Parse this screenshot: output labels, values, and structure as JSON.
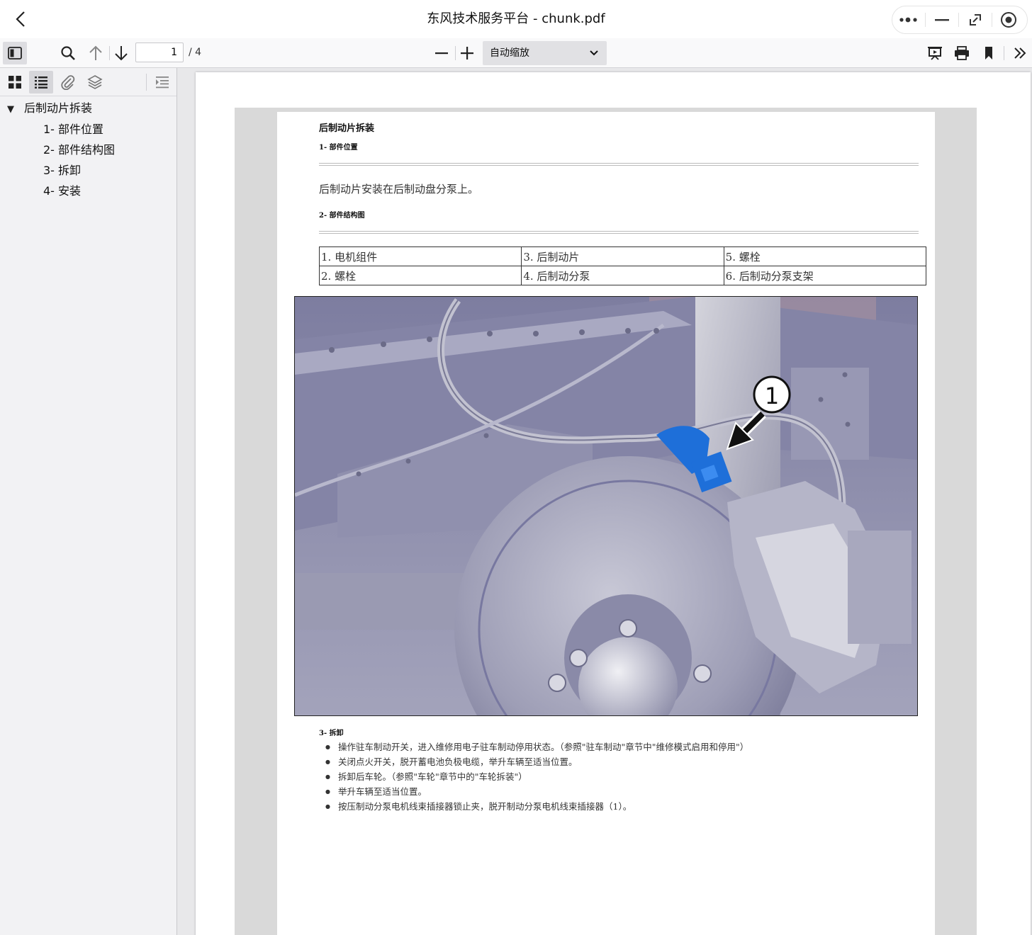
{
  "window": {
    "title": "东风技术服务平台 - chunk.pdf"
  },
  "toolbar": {
    "page_number": "1",
    "page_total": "/ 4",
    "zoom_label": "自动缩放"
  },
  "outline": {
    "root": "后制动片拆装",
    "items": [
      "1- 部件位置",
      "2- 部件结构图",
      "3- 拆卸",
      "4- 安装"
    ]
  },
  "document": {
    "title": "后制动片拆装",
    "section1_title": "1- 部件位置",
    "section1_text": "后制动片安装在后制动盘分泵上。",
    "section2_title": "2- 部件结构图",
    "parts_table": [
      [
        "1. 电机组件",
        "3. 后制动片",
        "5. 螺栓"
      ],
      [
        "2. 螺栓",
        "4. 后制动分泵",
        "6. 后制动分泵支架"
      ]
    ],
    "figure_callout": "1",
    "section3_title": "3- 拆卸",
    "steps": [
      "操作驻车制动开关，进入维修用电子驻车制动停用状态。（参照\"驻车制动\"章节中\"维修模式启用和停用\"）",
      "关闭点火开关，脱开蓄电池负极电缆，举升车辆至适当位置。",
      "拆卸后车轮。（参照\"车轮\"章节中的\"车轮拆装\"）",
      "举升车辆至适当位置。",
      "按压制动分泵电机线束插接器锁止夹，脱开制动分泵电机线束插接器（1）。"
    ]
  },
  "colors": {
    "accent_blue": "#1e6fd9",
    "figure_steel": "#8f8fb0"
  }
}
